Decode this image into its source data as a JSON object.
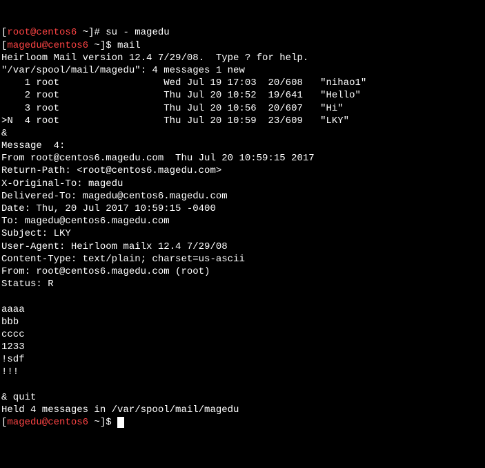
{
  "lines": {
    "l1_open": "[",
    "l1_user": "root@centos6",
    "l1_close": " ~]# ",
    "l1_cmd": "su - magedu",
    "l2_open": "[",
    "l2_user": "magedu@centos6",
    "l2_close": " ~]$ ",
    "l2_cmd": "mail",
    "l3": "Heirloom Mail version 12.4 7/29/08.  Type ? for help.",
    "l4": "\"/var/spool/mail/magedu\": 4 messages 1 new",
    "l5": "    1 root                  Wed Jul 19 17:03  20/608   \"nihao1\"",
    "l6": "    2 root                  Thu Jul 20 10:52  19/641   \"Hello\"",
    "l7": "    3 root                  Thu Jul 20 10:56  20/607   \"Hi\"",
    "l8": ">N  4 root                  Thu Jul 20 10:59  23/609   \"LKY\"",
    "l9": "&",
    "l10": "Message  4:",
    "l11": "From root@centos6.magedu.com  Thu Jul 20 10:59:15 2017",
    "l12": "Return-Path: <root@centos6.magedu.com>",
    "l13": "X-Original-To: magedu",
    "l14": "Delivered-To: magedu@centos6.magedu.com",
    "l15": "Date: Thu, 20 Jul 2017 10:59:15 -0400",
    "l16": "To: magedu@centos6.magedu.com",
    "l17": "Subject: LKY",
    "l18": "User-Agent: Heirloom mailx 12.4 7/29/08",
    "l19": "Content-Type: text/plain; charset=us-ascii",
    "l20": "From: root@centos6.magedu.com (root)",
    "l21": "Status: R",
    "l22": "",
    "l23": "aaaa",
    "l24": "bbb",
    "l25": "cccc",
    "l26": "1233",
    "l27": "!sdf",
    "l28": "!!!",
    "l29": "",
    "l30": "& quit",
    "l31": "Held 4 messages in /var/spool/mail/magedu",
    "l32_open": "[",
    "l32_user": "magedu@centos6",
    "l32_close": " ~]$ "
  }
}
